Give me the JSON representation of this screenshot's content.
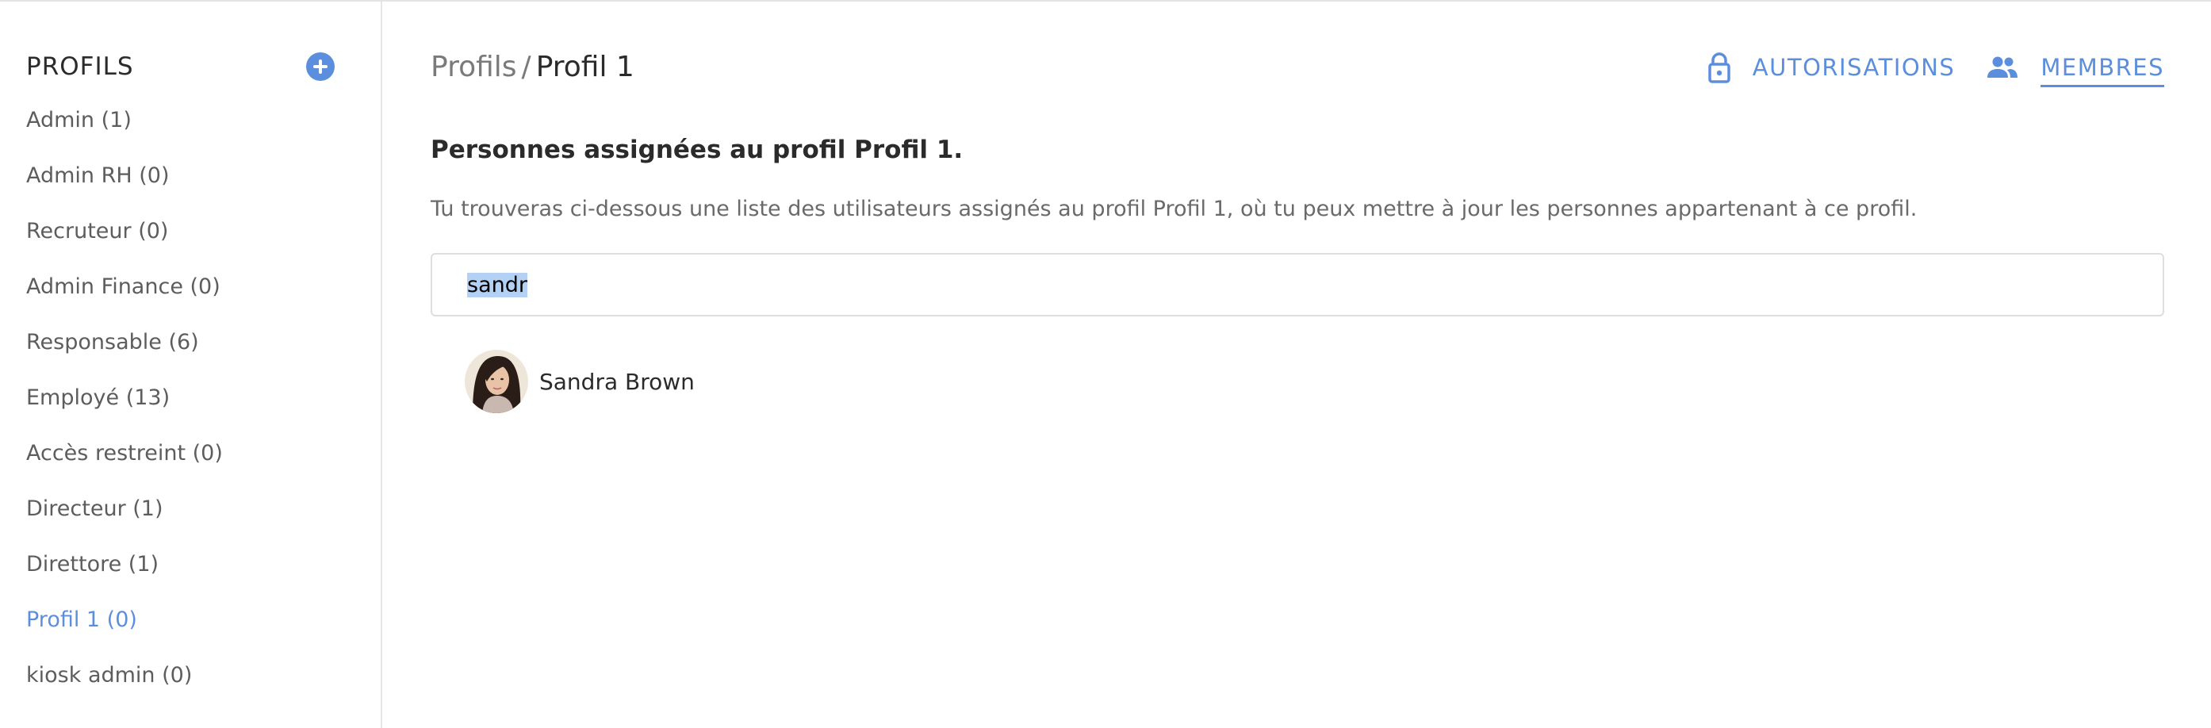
{
  "sidebar": {
    "title": "PROFILS",
    "profiles": [
      {
        "label": "Admin (1)"
      },
      {
        "label": "Admin RH (0)"
      },
      {
        "label": "Recruteur (0)"
      },
      {
        "label": "Admin Finance (0)"
      },
      {
        "label": "Responsable (6)"
      },
      {
        "label": "Employé (13)"
      },
      {
        "label": "Accès restreint (0)"
      },
      {
        "label": "Directeur (1)"
      },
      {
        "label": "Direttore (1)"
      },
      {
        "label": "Profil 1 (0)",
        "active": true
      },
      {
        "label": "kiosk admin (0)"
      }
    ]
  },
  "breadcrumb": {
    "parent": "Profils",
    "separator": "/",
    "current": "Profil 1"
  },
  "tabs": {
    "permissions": {
      "label": "AUTORISATIONS",
      "icon": "lock-icon"
    },
    "members": {
      "label": "MEMBRES",
      "icon": "people-icon",
      "active": true
    }
  },
  "main": {
    "title": "Personnes assignées au profil Profil 1.",
    "description": "Tu trouveras ci-dessous une liste des utilisateurs assignés au profil Profil 1, où tu peux mettre à jour les personnes appartenant à ce profil.",
    "search_value": "sandr",
    "members": [
      {
        "name": "Sandra Brown",
        "avatar": "user-avatar"
      }
    ]
  },
  "colors": {
    "accent": "#5b8fde",
    "text": "#2b2b2b",
    "muted": "#6a6a6a",
    "border": "#dedede"
  }
}
